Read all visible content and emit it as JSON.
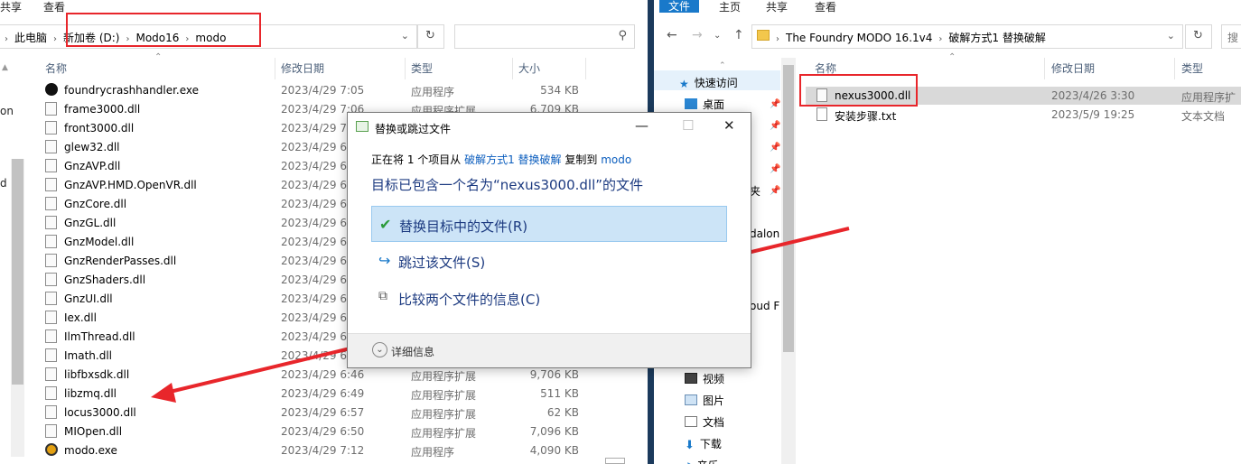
{
  "left": {
    "ribbon": {
      "share": "共享",
      "view": "查看"
    },
    "breadcrumbs": [
      "此电脑",
      "新加卷 (D:)",
      "Modo16",
      "modo"
    ],
    "columns": {
      "name": "名称",
      "date": "修改日期",
      "type": "类型",
      "size": "大小"
    },
    "nav_fragments": [
      "on",
      "d F"
    ],
    "files": [
      {
        "name": "foundrycrashhandler.exe",
        "date": "2023/4/29 7:05",
        "type": "应用程序",
        "size": "534 KB",
        "icon": "exe-icon"
      },
      {
        "name": "frame3000.dll",
        "date": "2023/4/29 7:06",
        "type": "应用程序扩展",
        "size": "6,709 KB",
        "icon": "dll-icon"
      },
      {
        "name": "front3000.dll",
        "date": "2023/4/29 7:",
        "type": "",
        "size": "",
        "icon": "dll-icon"
      },
      {
        "name": "glew32.dll",
        "date": "2023/4/29 6:",
        "type": "",
        "size": "",
        "icon": "dll-icon"
      },
      {
        "name": "GnzAVP.dll",
        "date": "2023/4/29 6:",
        "type": "",
        "size": "",
        "icon": "dll-icon"
      },
      {
        "name": "GnzAVP.HMD.OpenVR.dll",
        "date": "2023/4/29 6:",
        "type": "",
        "size": "",
        "icon": "dll-icon"
      },
      {
        "name": "GnzCore.dll",
        "date": "2023/4/29 6:",
        "type": "",
        "size": "",
        "icon": "dll-icon"
      },
      {
        "name": "GnzGL.dll",
        "date": "2023/4/29 6:",
        "type": "",
        "size": "",
        "icon": "dll-icon"
      },
      {
        "name": "GnzModel.dll",
        "date": "2023/4/29 6:",
        "type": "",
        "size": "",
        "icon": "dll-icon"
      },
      {
        "name": "GnzRenderPasses.dll",
        "date": "2023/4/29 6:",
        "type": "",
        "size": "",
        "icon": "dll-icon"
      },
      {
        "name": "GnzShaders.dll",
        "date": "2023/4/29 6:",
        "type": "",
        "size": "",
        "icon": "dll-icon"
      },
      {
        "name": "GnzUI.dll",
        "date": "2023/4/29 6:",
        "type": "",
        "size": "",
        "icon": "dll-icon"
      },
      {
        "name": "Iex.dll",
        "date": "2023/4/29 6:",
        "type": "",
        "size": "",
        "icon": "dll-icon"
      },
      {
        "name": "IlmThread.dll",
        "date": "2023/4/29 6:",
        "type": "",
        "size": "",
        "icon": "dll-icon"
      },
      {
        "name": "Imath.dll",
        "date": "2023/4/29 6:",
        "type": "",
        "size": "",
        "icon": "dll-icon"
      },
      {
        "name": "libfbxsdk.dll",
        "date": "2023/4/29 6:46",
        "type": "应用程序扩展",
        "size": "9,706 KB",
        "icon": "dll-icon"
      },
      {
        "name": "libzmq.dll",
        "date": "2023/4/29 6:49",
        "type": "应用程序扩展",
        "size": "511 KB",
        "icon": "dll-icon"
      },
      {
        "name": "locus3000.dll",
        "date": "2023/4/29 6:57",
        "type": "应用程序扩展",
        "size": "62 KB",
        "icon": "dll-icon"
      },
      {
        "name": "MIOpen.dll",
        "date": "2023/4/29 6:50",
        "type": "应用程序扩展",
        "size": "7,096 KB",
        "icon": "dll-icon"
      },
      {
        "name": "modo.exe",
        "date": "2023/4/29 7:12",
        "type": "应用程序",
        "size": "4,090 KB",
        "icon": "modo-exe-icon"
      }
    ]
  },
  "right": {
    "ribbon": {
      "file": "文件",
      "home": "主页",
      "share": "共享",
      "view": "查看"
    },
    "breadcrumbs": [
      "The Foundry MODO 16.1v4",
      "破解方式1 替换破解"
    ],
    "search_fragment": "搜",
    "columns": {
      "name": "名称",
      "date": "修改日期",
      "type": "类型"
    },
    "files": [
      {
        "name": "nexus3000.dll",
        "date": "2023/4/26 3:30",
        "type": "应用程序扩",
        "selected": true
      },
      {
        "name": "安装步骤.txt",
        "date": "2023/5/9 19:25",
        "type": "文本文档",
        "selected": false
      }
    ],
    "nav": {
      "quick_access": "快速访问",
      "desktop": "桌面",
      "frag1": "夹",
      "frag2": "dalon",
      "frag3": "oud F",
      "videos": "视频",
      "pictures": "图片",
      "documents": "文档",
      "downloads": "下载",
      "frag4": "音乐"
    }
  },
  "dialog": {
    "title": "替换或跳过文件",
    "copying_prefix": "正在将 1 个项目从",
    "source": "破解方式1 替换破解",
    "copy_to": "复制到",
    "dest": "modo",
    "message": "目标已包含一个名为“nexus3000.dll”的文件",
    "replace": "替换目标中的文件(R)",
    "skip": "跳过该文件(S)",
    "compare": "比较两个文件的信息(C)",
    "details": "详细信息"
  },
  "colors": {
    "annotation": "#e8262b",
    "accent": "#1979ca",
    "selection": "#cce4f7",
    "link": "#0c5ebe"
  }
}
